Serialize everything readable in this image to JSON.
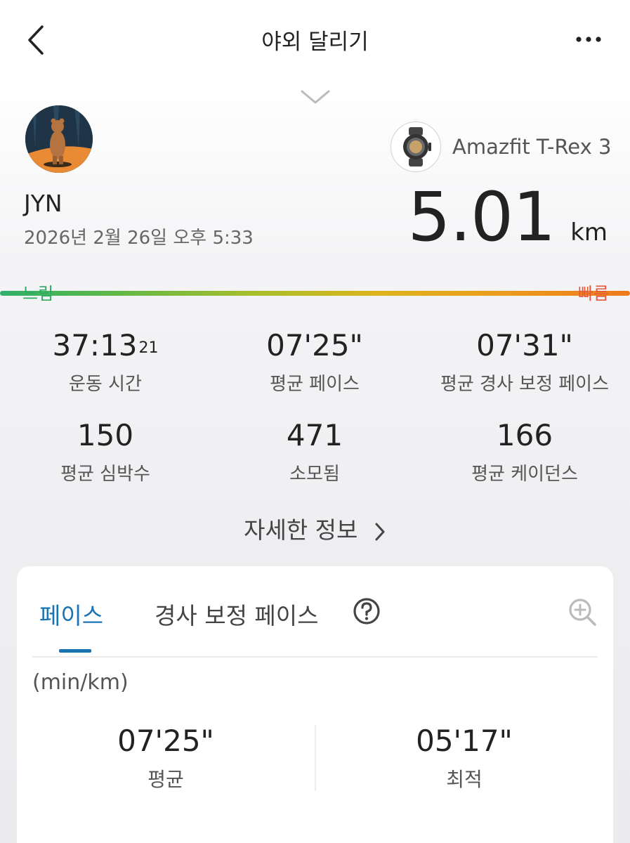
{
  "header": {
    "title": "야외 달리기"
  },
  "profile": {
    "username": "JYN",
    "datetime": "2026년 2월 26일 오후 5:33"
  },
  "device": {
    "name": "Amazfit T-Rex 3"
  },
  "distance": {
    "value": "5.01",
    "unit": "km"
  },
  "pace_scale": {
    "slow_label": "느림",
    "fast_label": "빠름"
  },
  "stats": [
    {
      "value": "37:13",
      "sup": "21",
      "label": "운동 시간"
    },
    {
      "value": "07'25\"",
      "label": "평균 페이스"
    },
    {
      "value": "07'31\"",
      "label": "평균 경사 보정 페이스"
    },
    {
      "value": "150",
      "label": "평균 심박수"
    },
    {
      "value": "471",
      "label": "소모됨"
    },
    {
      "value": "166",
      "label": "평균 케이던스"
    }
  ],
  "details_link": {
    "label": "자세한 정보"
  },
  "pace_card": {
    "tabs": [
      {
        "label": "페이스",
        "active": true
      },
      {
        "label": "경사 보정 페이스",
        "active": false
      }
    ],
    "unit": "(min/km)",
    "summary": [
      {
        "value": "07'25\"",
        "label": "평균"
      },
      {
        "value": "05'17\"",
        "label": "최적"
      }
    ]
  },
  "colors": {
    "accent": "#1a74b3",
    "slow": "#2dac61",
    "fast": "#e5593a"
  },
  "icons": [
    "back-arrow-icon",
    "more-icon",
    "chevron-down-icon",
    "watch-icon",
    "chevron-right-icon",
    "help-icon",
    "zoom-in-icon"
  ]
}
